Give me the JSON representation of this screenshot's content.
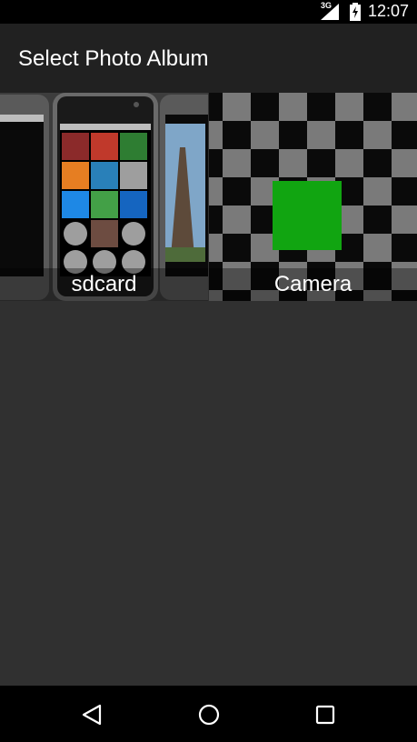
{
  "status_bar": {
    "network": "3G",
    "time": "12:07"
  },
  "app_bar": {
    "title": "Select Photo Album"
  },
  "albums": [
    {
      "label": "sdcard",
      "thumbnail": "phone-screenshots-collage"
    },
    {
      "label": "Camera",
      "thumbnail": "checkerboard-green-square"
    }
  ],
  "nav_bar": {
    "back_icon": "back-triangle-icon",
    "home_icon": "home-circle-icon",
    "recents_icon": "recents-square-icon"
  },
  "colors": {
    "status_bar_bg": "#000000",
    "app_bar_bg": "#212121",
    "content_bg": "#303030",
    "nav_bar_bg": "#000000",
    "camera_green": "#11A511"
  }
}
